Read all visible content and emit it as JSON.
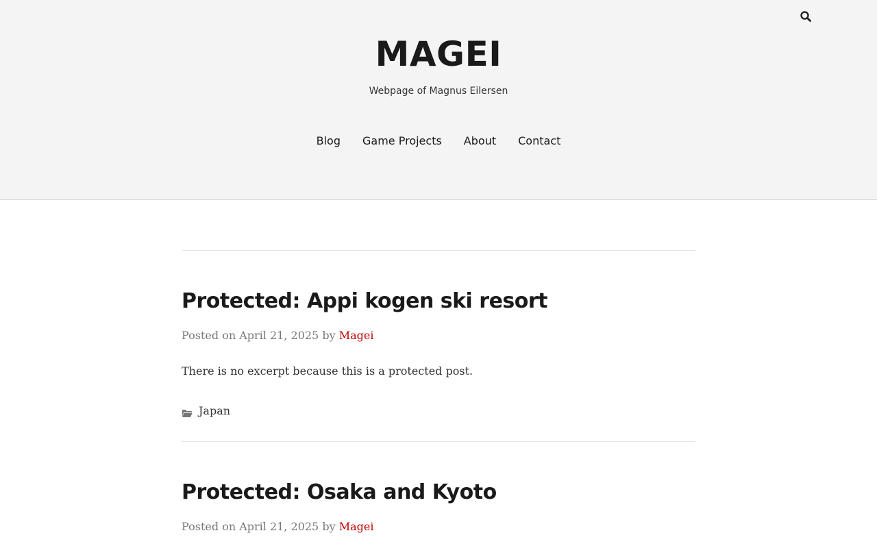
{
  "header": {
    "site_title": "MAGEI",
    "site_description": "Webpage of Magnus Eilersen",
    "search_icon": "search-icon"
  },
  "nav": {
    "items": [
      {
        "label": "Blog"
      },
      {
        "label": "Game Projects"
      },
      {
        "label": "About"
      },
      {
        "label": "Contact"
      }
    ]
  },
  "posts": [
    {
      "title": "Protected: Appi kogen ski resort",
      "posted_on_label": "Posted on",
      "date": "April 21, 2025",
      "by_label": "by",
      "author": "Magei",
      "excerpt": "There is no excerpt because this is a protected post.",
      "category_icon": "folder-open-icon",
      "category": "Japan"
    },
    {
      "title": "Protected: Osaka and Kyoto",
      "posted_on_label": "Posted on",
      "date": "April 21, 2025",
      "by_label": "by",
      "author": "Magei"
    }
  ],
  "colors": {
    "header_bg": "#f4f4f4",
    "accent": "#c00000",
    "text": "#333333",
    "title": "#1a1a1a",
    "meta": "#777777"
  }
}
